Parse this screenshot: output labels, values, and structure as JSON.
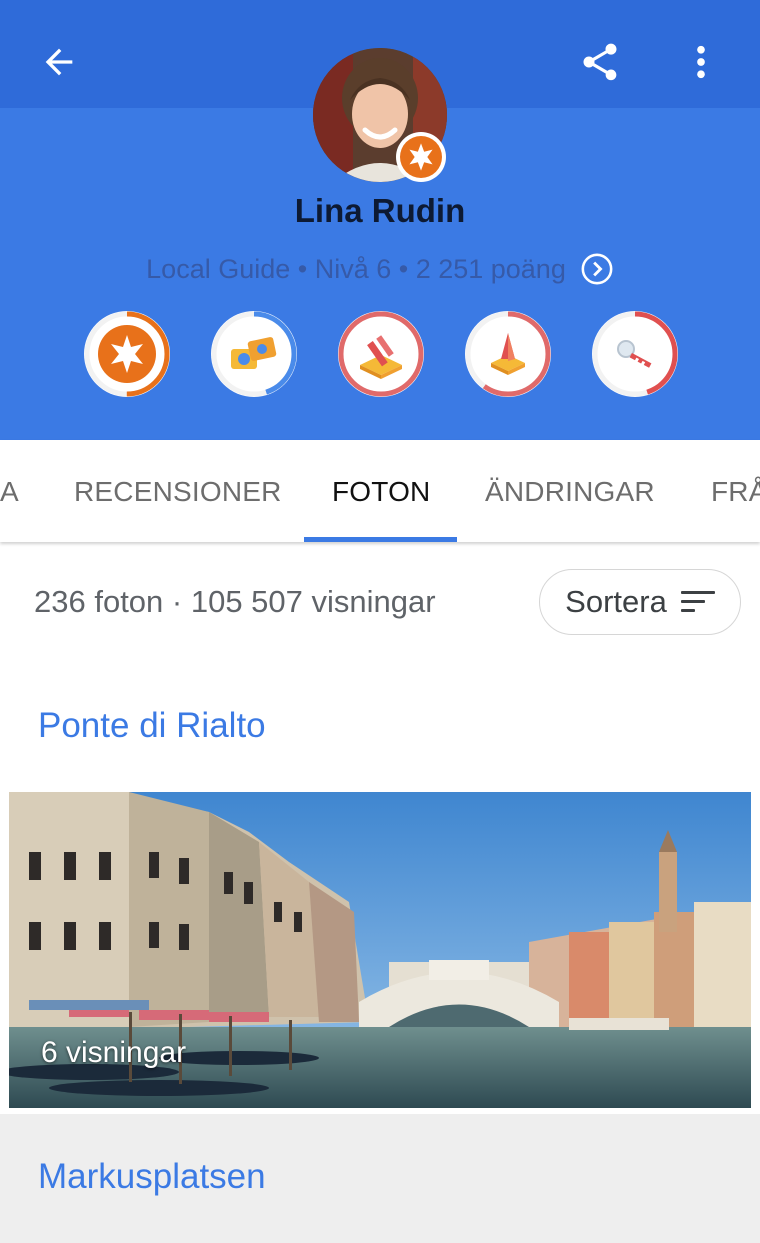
{
  "profile": {
    "name": "Lina Rudin",
    "subtitle": "Local Guide • Nivå 6 • 2 251 poäng"
  },
  "header_icons": [
    "arrow-left-icon",
    "share-icon",
    "more-vert-icon"
  ],
  "badges": [
    {
      "name": "local-guide-badge",
      "progress": 0.5
    },
    {
      "name": "photographer-badge",
      "progress": 0.45
    },
    {
      "name": "reviewer-badge",
      "progress": 1.0
    },
    {
      "name": "trailblazer-badge",
      "progress": 0.6
    },
    {
      "name": "fact-finder-badge",
      "progress": 0.45
    }
  ],
  "tabs": [
    {
      "label": "A"
    },
    {
      "label": "RECENSIONER"
    },
    {
      "label": "FOTON",
      "active": true
    },
    {
      "label": "ÄNDRINGAR"
    },
    {
      "label": "FRÅ"
    }
  ],
  "photos_summary": {
    "stats": "236 foton · 105 507 visningar",
    "sort_label": "Sortera"
  },
  "places": [
    {
      "title": "Ponte di Rialto",
      "views": "6 visningar"
    },
    {
      "title": "Markusplatsen"
    }
  ],
  "colors": {
    "header_top": "#2f6bd9",
    "header": "#3b7ae4",
    "accent": "#3b7ae4",
    "badge_orange": "#e8711a"
  }
}
